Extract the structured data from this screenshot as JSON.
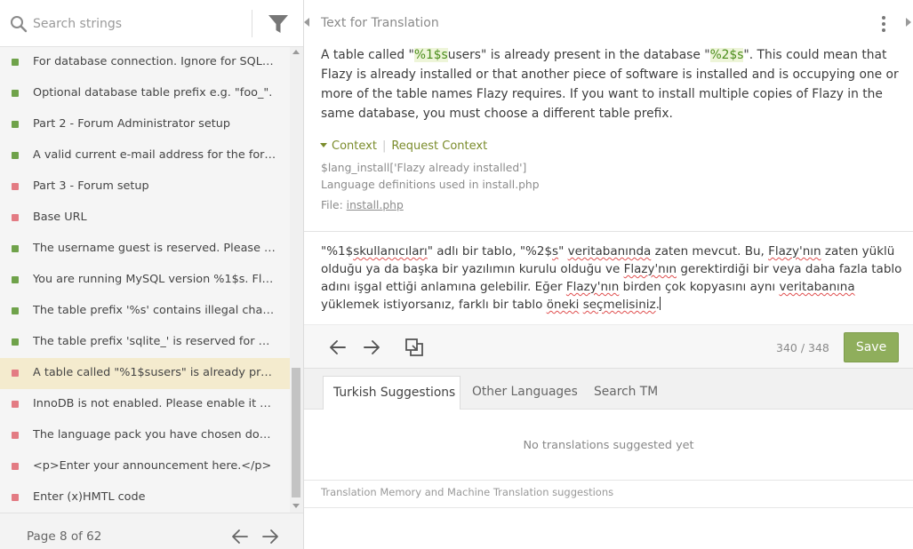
{
  "sidebar": {
    "search": {
      "placeholder": "Search strings",
      "value": ""
    },
    "filter_icon": "filter-funnel-icon",
    "items": [
      {
        "label": "For database connection. Ignore for SQLite.",
        "status": "translated",
        "active": false
      },
      {
        "label": "Optional database table prefix e.g. \"foo_\".",
        "status": "translated",
        "active": false
      },
      {
        "label": "Part 2 - Forum Administrator setup",
        "status": "translated",
        "active": false
      },
      {
        "label": "A valid current e-mail address for the foru...",
        "status": "translated",
        "active": false
      },
      {
        "label": "Part 3 - Forum setup",
        "status": "untranslated",
        "active": false
      },
      {
        "label": "Base URL",
        "status": "untranslated",
        "active": false
      },
      {
        "label": "The username guest is reserved. Please go ...",
        "status": "translated",
        "active": false
      },
      {
        "label": "You are running MySQL version %1$s. Flazy...",
        "status": "translated",
        "active": false
      },
      {
        "label": "The table prefix '%s' contains illegal charact...",
        "status": "translated",
        "active": false
      },
      {
        "label": "The table prefix 'sqlite_' is reserved for use ...",
        "status": "translated",
        "active": false
      },
      {
        "label": "A table called \"%1$susers\" is already prese...",
        "status": "untranslated",
        "active": true
      },
      {
        "label": "InnoDB is not enabled. Please enable it bef...",
        "status": "untranslated",
        "active": false
      },
      {
        "label": "The language pack you have chosen doesn'...",
        "status": "untranslated",
        "active": false
      },
      {
        "label": "<p>Enter your announcement here.</p>",
        "status": "untranslated",
        "active": false
      },
      {
        "label": "Enter (x)HMTL code",
        "status": "untranslated",
        "active": false
      }
    ],
    "pager": {
      "label": "Page 8 of 62"
    }
  },
  "colors": {
    "translated": "#6fa24a",
    "untranslated": "#e37b83",
    "active_row": "#f4ebce",
    "placeholder_text": "#4b8d1c",
    "save_button": "#8fae5c",
    "context_link": "#7b8c2c"
  },
  "editor": {
    "header": "Text for Translation",
    "source": {
      "p1": "A table called \"",
      "ph1": "%1$s",
      "p2": "users\" is already present in the database \"",
      "ph2": "%2$s",
      "p3": "\". This could mean that Flazy is already installed or that another piece of software is installed and is occupying one or more of the table names Flazy requires. If you want to install multiple copies of Flazy in the same database, you must choose a different table prefix."
    },
    "context": {
      "toggle_label": "Context",
      "request_label": "Request Context",
      "key": "$lang_install['Flazy already installed']",
      "description": "Language definitions used in install.php",
      "file_label": "File:",
      "file_link": "install.php"
    },
    "translation": {
      "t1": "\"%1$",
      "t2": "skullanıcıları",
      "t3": "\" adlı bir tablo, \"%2$",
      "t4": "s",
      "t5": "\" ",
      "t6": "veritabanında",
      "t7": " zaten mevcut. Bu, ",
      "t8": "Flazy'nın",
      "t9": " zaten yüklü olduğu ya da başka bir yazılımın kurulu olduğu ve ",
      "t10": "Flazy'nın",
      "t11": " gerektirdiği bir veya daha fazla tablo adını işgal ettiği anlamına gelebilir. Eğer ",
      "t12": "Flazy'nın",
      "t13": " birden çok kopyasını aynı ",
      "t14": "veritabanına",
      "t15": " yüklemek istiyorsanız, farklı bir tablo ",
      "t16": "öneki",
      "t17": " ",
      "t18": "seçmelisiniz",
      "t19": "."
    },
    "toolbar": {
      "char_count": "340 / 348",
      "save_label": "Save"
    }
  },
  "suggestions": {
    "tabs": [
      "Turkish Suggestions",
      "Other Languages",
      "Search TM"
    ],
    "empty_message": "No translations suggested yet",
    "footer_note": "Translation Memory and Machine Translation suggestions"
  }
}
